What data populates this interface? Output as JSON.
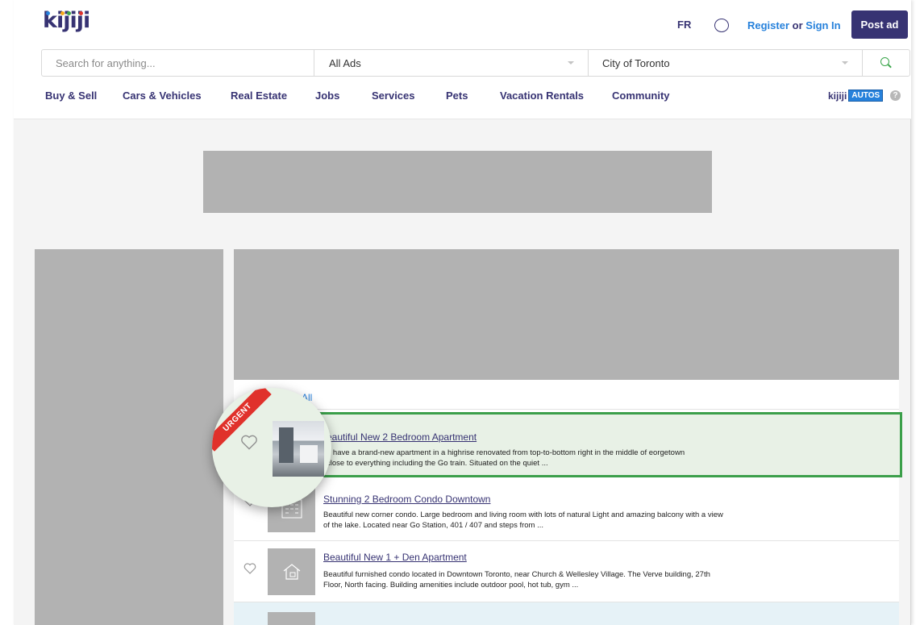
{
  "header": {
    "logo_text": "kijiji",
    "logo_colors": [
      "#2681db",
      "#f8aa17",
      "#3aa54a",
      "#e0312b",
      "#9b44ad"
    ],
    "language": "FR",
    "chat_icon": "chat-bubble-icon",
    "register": "Register",
    "or_text": "or",
    "sign_in": "Sign In",
    "post_ad": "Post ad"
  },
  "search": {
    "placeholder": "Search for anything...",
    "category": "All Ads",
    "location": "City of Toronto",
    "search_icon": "search-icon"
  },
  "nav": {
    "items": [
      "Buy & Sell",
      "Cars & Vehicles",
      "Real Estate",
      "Jobs",
      "Services",
      "Pets",
      "Vacation Rentals",
      "Community"
    ],
    "autos_brand": "kijiji",
    "autos_badge": "AUTOS",
    "help": "?"
  },
  "results": {
    "all_link": "All",
    "listings": [
      {
        "title": "Beautiful New 2 Bedroom Apartment",
        "title_visible": "eautiful New 2 Bedroom Apartment",
        "desc_visible": "e have a brand-new apartment in a highrise renovated from top-to-bottom right in the middle of eorgetown close to everything including the Go train. Situated on the quiet ...",
        "badge": "URGENT",
        "highlighted": true
      },
      {
        "title": "Stunning 2 Bedroom Condo Downtown",
        "desc": "Beautiful new corner condo. Large bedroom and living room with lots of natural Light and amazing balcony with a view of the lake. Located near Go Station, 401 / 407 and steps from ..."
      },
      {
        "title": "Beautiful New 1 + Den Apartment",
        "desc": "Beautiful furnished condo located in Downtown Toronto, near Church & Wellesley Village. The Verve building, 27th Floor, North facing. Building amenities include outdoor pool, hot tub, gym ..."
      }
    ]
  },
  "colors": {
    "brand_navy": "#373373",
    "link_blue": "#2681db",
    "highlight_green": "#3b9f4a",
    "urgent_red": "#e0312b",
    "placeholder_gray": "#b2b2b2"
  }
}
